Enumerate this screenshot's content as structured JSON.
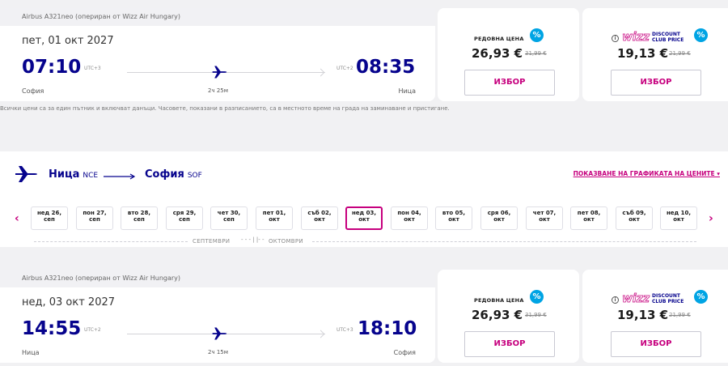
{
  "flights": [
    {
      "aircraft": "Airbus A321neo (опериран от Wizz Air Hungary)",
      "date": "пет, 01 окт 2027",
      "depart_time": "07:10",
      "depart_tz": "UTC+3",
      "arrive_time": "08:35",
      "arrive_tz": "UTC+2",
      "from_city": "София",
      "to_city": "Ница",
      "duration": "2ч 25м",
      "regular_label": "РЕДОВНА ЦЕНА",
      "regular_price": "26,93 €",
      "regular_old": "31,99 €",
      "club_price": "19,13 €",
      "club_old": "21,99 €",
      "select_label": "ИЗБОР"
    },
    {
      "aircraft": "Airbus A321neo (опериран от Wizz Air Hungary)",
      "date": "нед, 03 окт 2027",
      "depart_time": "14:55",
      "depart_tz": "UTC+2",
      "arrive_time": "18:10",
      "arrive_tz": "UTC+3",
      "from_city": "Ница",
      "to_city": "София",
      "duration": "2ч 15м",
      "regular_label": "РЕДОВНА ЦЕНА",
      "regular_price": "26,93 €",
      "regular_old": "31,99 €",
      "club_price": "19,13 €",
      "club_old": "21,99 €",
      "select_label": "ИЗБОР"
    }
  ],
  "club_logo": {
    "brand": "wizz",
    "line1": "DISCOUNT",
    "line2": "CLUB PRICE"
  },
  "percent_badge": "%",
  "info_icon": "i",
  "disclaimer": "Всички цени са за един пътник и включват данъци. Часовете, показани в разписанието, са в местното време на града на заминаване и пристигане.",
  "return_route": {
    "from_city": "Ница",
    "from_code": "NCE",
    "to_city": "София",
    "to_code": "SOF",
    "chart_link": "ПОКАЗВАНЕ НА ГРАФИКАТА НА ЦЕНИТЕ ▾"
  },
  "date_strip": {
    "prev": "‹",
    "next": "›",
    "dates": [
      {
        "day": "нед 26,",
        "month": "сеп"
      },
      {
        "day": "пон 27,",
        "month": "сеп"
      },
      {
        "day": "вто 28,",
        "month": "сеп"
      },
      {
        "day": "сря 29,",
        "month": "сеп"
      },
      {
        "day": "чет 30,",
        "month": "сеп"
      },
      {
        "day": "пет 01,",
        "month": "окт"
      },
      {
        "day": "съб 02,",
        "month": "окт"
      },
      {
        "day": "нед 03,",
        "month": "окт",
        "selected": true
      },
      {
        "day": "пон 04,",
        "month": "окт"
      },
      {
        "day": "вто 05,",
        "month": "окт"
      },
      {
        "day": "сря 06,",
        "month": "окт"
      },
      {
        "day": "чет 07,",
        "month": "окт"
      },
      {
        "day": "пет 08,",
        "month": "окт"
      },
      {
        "day": "съб 09,",
        "month": "окт"
      },
      {
        "day": "нед 10,",
        "month": "окт"
      }
    ],
    "month_left": "СЕПТЕМВРИ",
    "month_right": "ОКТОМВРИ"
  },
  "colors": {
    "navy": "#06038d",
    "magenta": "#c6007e",
    "cyan": "#00a4e4"
  }
}
